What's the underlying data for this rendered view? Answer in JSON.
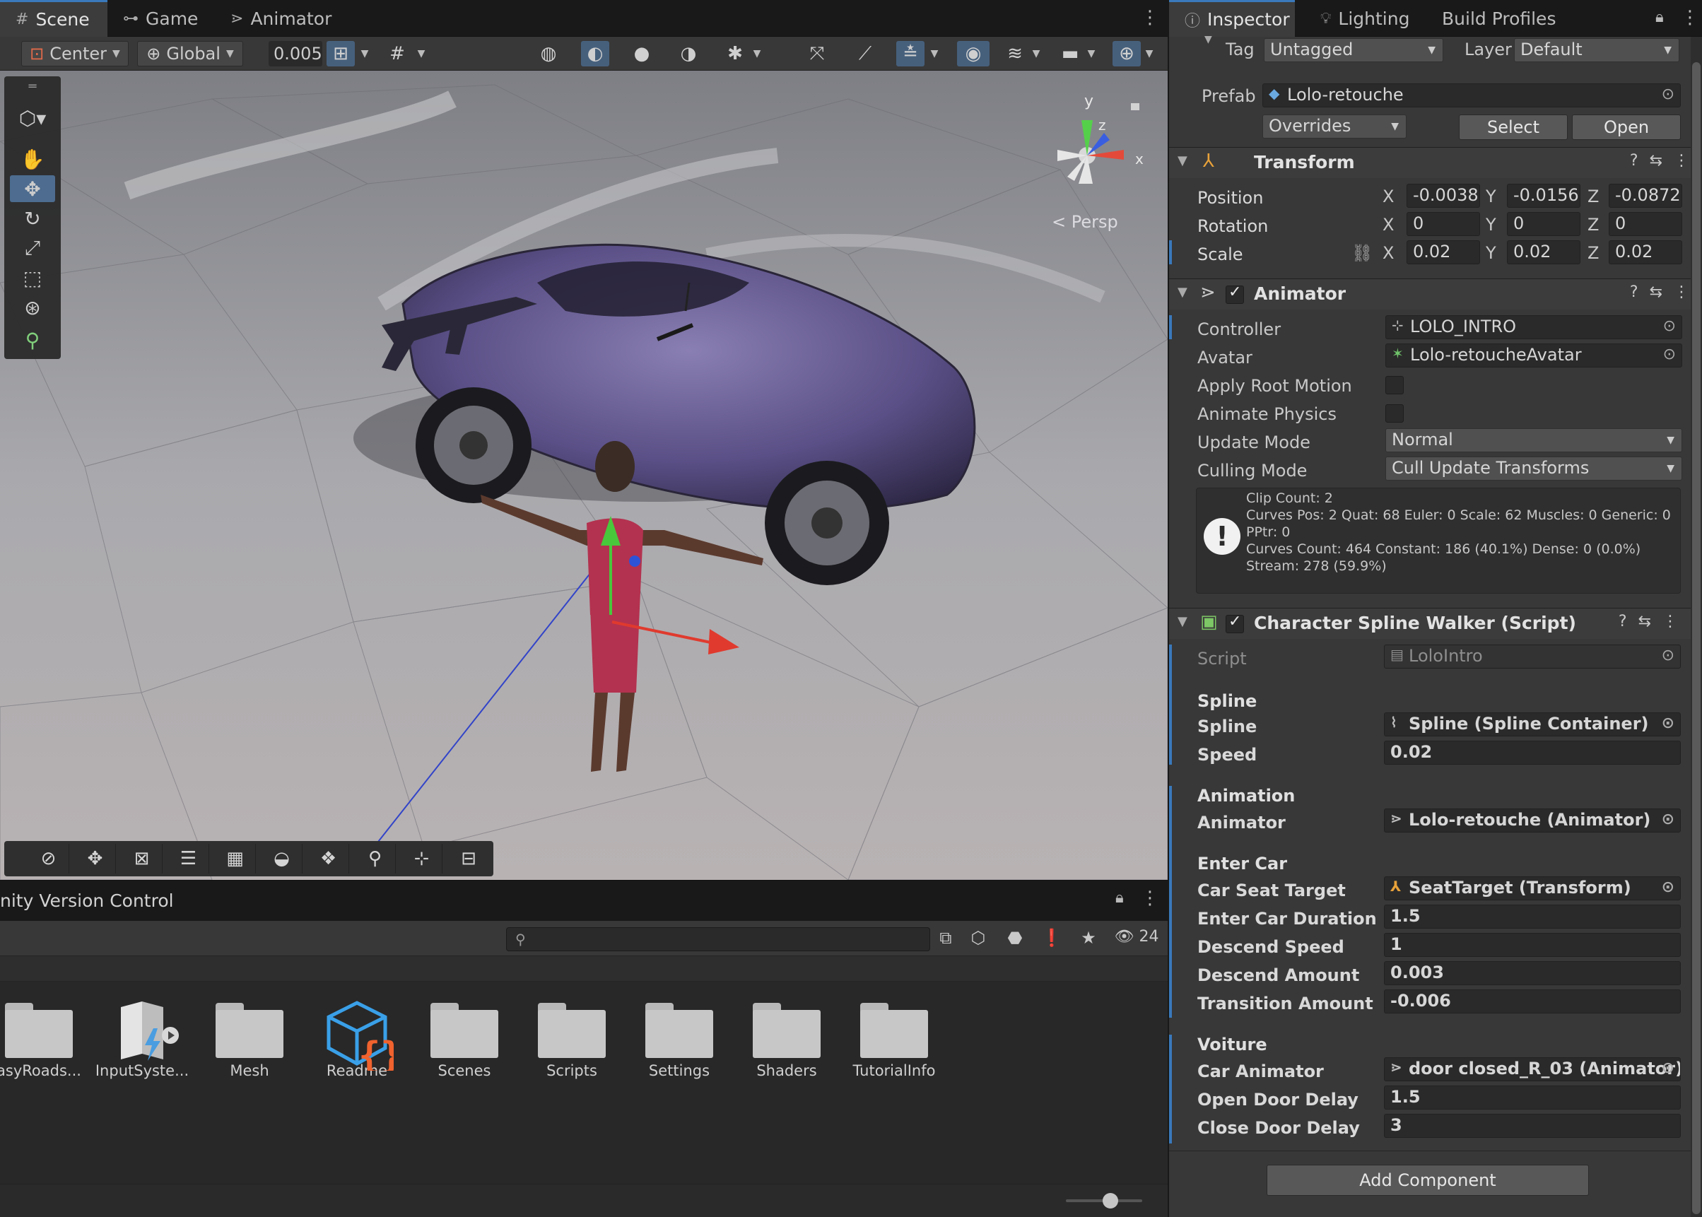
{
  "scene_tabs": {
    "scene": "Scene",
    "game": "Game",
    "animator": "Animator"
  },
  "scene_toolbar": {
    "pivot": "Center",
    "space": "Global",
    "snap_value": "0.005"
  },
  "viewport": {
    "persp_label": "< Persp",
    "gizmo_axes": {
      "x": "x",
      "y": "y",
      "z": "z"
    }
  },
  "project": {
    "title": "nity Version Control",
    "search_placeholder": "",
    "visible_count": "24",
    "assets": [
      "asyRoads...",
      "InputSyste...",
      "Mesh",
      "Readme",
      "Scenes",
      "Scripts",
      "Settings",
      "Shaders",
      "TutorialInfo"
    ]
  },
  "inspector_tabs": {
    "inspector": "Inspector",
    "lighting": "Lighting",
    "build_profiles": "Build Profiles"
  },
  "header": {
    "tag_label": "Tag",
    "tag_value": "Untagged",
    "layer_label": "Layer",
    "layer_value": "Default",
    "prefab_label": "Prefab",
    "prefab_value": "Lolo-retouche",
    "overrides": "Overrides",
    "select": "Select",
    "open": "Open"
  },
  "transform": {
    "title": "Transform",
    "position_label": "Position",
    "rotation_label": "Rotation",
    "scale_label": "Scale",
    "position": {
      "x": "-0.0038",
      "y": "-0.0156",
      "z": "-0.0872"
    },
    "rotation": {
      "x": "0",
      "y": "0",
      "z": "0"
    },
    "scale": {
      "x": "0.02",
      "y": "0.02",
      "z": "0.02"
    },
    "axis_x": "X",
    "axis_y": "Y",
    "axis_z": "Z"
  },
  "animator": {
    "title": "Animator",
    "controller_label": "Controller",
    "controller": "LOLO_INTRO",
    "avatar_label": "Avatar",
    "avatar": "Lolo-retoucheAvatar",
    "apply_root_motion_label": "Apply Root Motion",
    "animate_physics_label": "Animate Physics",
    "update_mode_label": "Update Mode",
    "update_mode": "Normal",
    "culling_mode_label": "Culling Mode",
    "culling_mode": "Cull Update Transforms",
    "info_lines": [
      "Clip Count: 2",
      "Curves Pos: 2 Quat: 68 Euler: 0 Scale: 62 Muscles: 0 Generic: 0",
      "PPtr: 0",
      "Curves Count: 464 Constant: 186 (40.1%) Dense: 0 (0.0%)",
      "Stream: 278 (59.9%)"
    ]
  },
  "spline_walker": {
    "title": "Character Spline Walker (Script)",
    "script_label": "Script",
    "script": "LoloIntro",
    "spline_section": "Spline",
    "spline_label": "Spline",
    "spline": "Spline (Spline Container)",
    "speed_label": "Speed",
    "speed": "0.02",
    "animation_section": "Animation",
    "animator_label": "Animator",
    "animator": "Lolo-retouche (Animator)",
    "enter_car_section": "Enter Car",
    "car_seat_target_label": "Car Seat Target",
    "car_seat_target": "SeatTarget (Transform)",
    "enter_car_duration_label": "Enter Car Duration",
    "enter_car_duration": "1.5",
    "descend_speed_label": "Descend Speed",
    "descend_speed": "1",
    "descend_amount_label": "Descend Amount",
    "descend_amount": "0.003",
    "transition_amount_label": "Transition Amount",
    "transition_amount": "-0.006",
    "voiture_section": "Voiture",
    "car_animator_label": "Car Animator",
    "car_animator": "door closed_R_03 (Animator)",
    "open_door_delay_label": "Open Door Delay",
    "open_door_delay": "1.5",
    "close_door_delay_label": "Close Door Delay",
    "close_door_delay": "3"
  },
  "add_component": "Add Component",
  "colors": {
    "accent": "#3a79bb",
    "car_body": "#5a4f86",
    "character_dress": "#b3324f"
  }
}
